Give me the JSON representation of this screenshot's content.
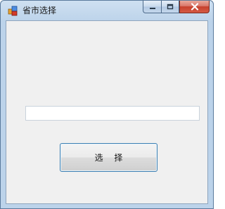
{
  "window": {
    "title": "省市选择",
    "icon": "form-app-icon",
    "caption_buttons": [
      "minimize-icon",
      "maximize-icon",
      "close-icon"
    ]
  },
  "form": {
    "text_input": {
      "value": "",
      "placeholder": ""
    },
    "select_button_label": "选 择"
  },
  "colors": {
    "title_bar": "#bcd3ea",
    "client_bg": "#f0f0f0",
    "close_button": "#c6402c",
    "button_border": "#3c7fb1"
  }
}
